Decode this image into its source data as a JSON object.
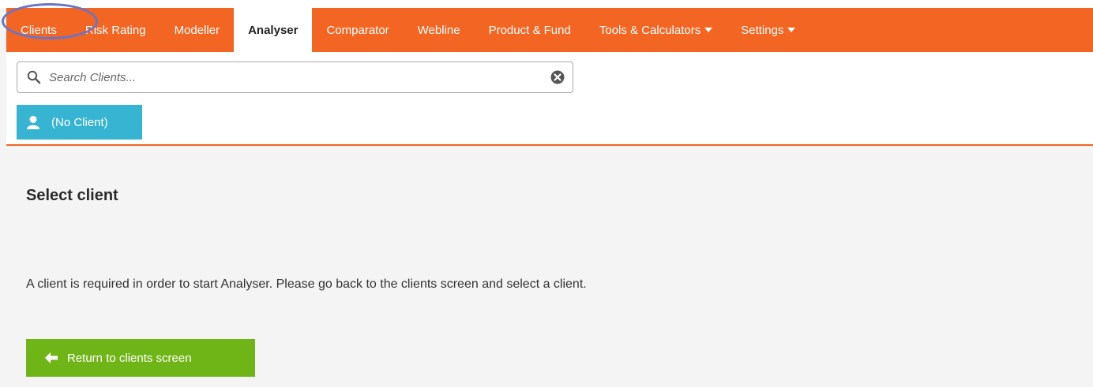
{
  "nav": {
    "items": [
      {
        "label": "Clients"
      },
      {
        "label": "Risk Rating"
      },
      {
        "label": "Modeller"
      },
      {
        "label": "Analyser"
      },
      {
        "label": "Comparator"
      },
      {
        "label": "Webline"
      },
      {
        "label": "Product & Fund"
      },
      {
        "label": "Tools & Calculators"
      },
      {
        "label": "Settings"
      }
    ],
    "active": "Analyser",
    "accent_color": "#f26522"
  },
  "search": {
    "placeholder": "Search Clients...",
    "value": ""
  },
  "client_selector": {
    "label": "(No Client)",
    "color": "#36b4d2"
  },
  "main": {
    "title": "Select client",
    "message": "A client is required in order to start Analyser. Please go back to the clients screen and select a client.",
    "return_button_label": "Return to clients screen",
    "return_button_color": "#6fb517"
  }
}
